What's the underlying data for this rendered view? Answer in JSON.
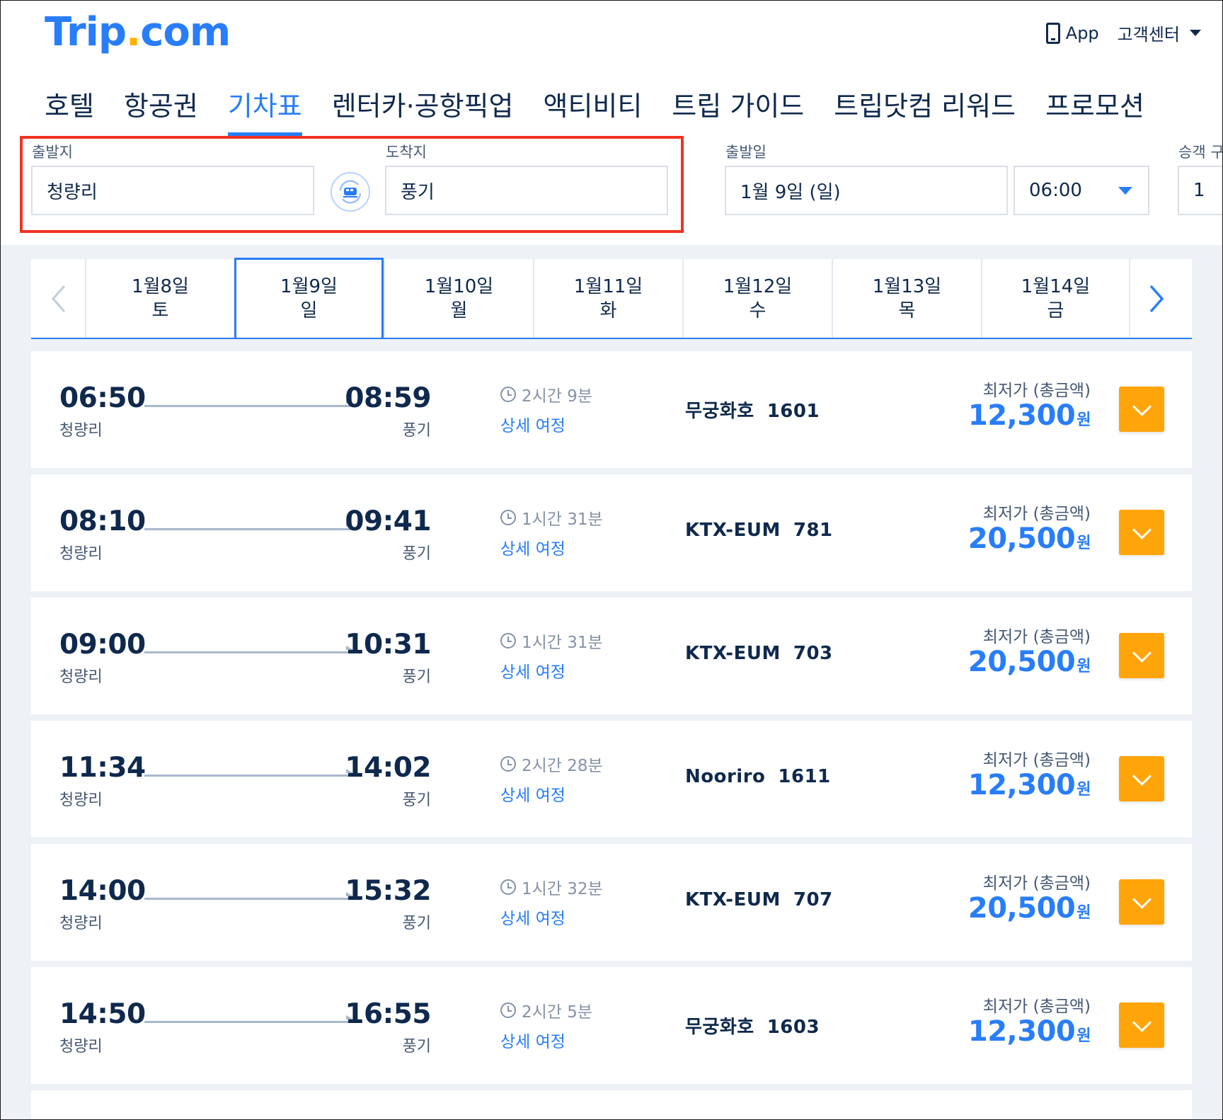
{
  "brand": {
    "name_part1": "Trip",
    "dot": ".",
    "name_part2": "com",
    "logo_color": "#287dfa",
    "dot_color": "#ffb000"
  },
  "header": {
    "app_label": "App",
    "support_label": "고객센터"
  },
  "tabs": [
    {
      "label": "호텔",
      "active": false
    },
    {
      "label": "항공권",
      "active": false
    },
    {
      "label": "기차표",
      "active": true
    },
    {
      "label": "렌터카·공항픽업",
      "active": false
    },
    {
      "label": "액티비티",
      "active": false
    },
    {
      "label": "트립 가이드",
      "active": false
    },
    {
      "label": "트립닷컴 리워드",
      "active": false
    },
    {
      "label": "프로모션",
      "active": false
    }
  ],
  "search": {
    "from_label": "출발지",
    "from_value": "청량리",
    "to_label": "도착지",
    "to_value": "풍기",
    "date_label": "출발일",
    "date_value": "1월 9일 (일)",
    "time_value": "06:00",
    "passenger_label": "승객 구",
    "passenger_value": "1"
  },
  "dates": [
    {
      "date": "1월8일",
      "day": "토"
    },
    {
      "date": "1월9일",
      "day": "일",
      "selected": true
    },
    {
      "date": "1월10일",
      "day": "월"
    },
    {
      "date": "1월11일",
      "day": "화"
    },
    {
      "date": "1월12일",
      "day": "수"
    },
    {
      "date": "1월13일",
      "day": "목"
    },
    {
      "date": "1월14일",
      "day": "금"
    }
  ],
  "results": [
    {
      "dep": "06:50",
      "dep_station": "청량리",
      "arr": "08:59",
      "arr_station": "풍기",
      "duration": "2시간 9분",
      "detail": "상세 여정",
      "train": "무궁화호",
      "number": "1601",
      "price_label": "최저가 (총금액)",
      "price": "12,300",
      "currency": "원"
    },
    {
      "dep": "08:10",
      "dep_station": "청량리",
      "arr": "09:41",
      "arr_station": "풍기",
      "duration": "1시간 31분",
      "detail": "상세 여정",
      "train": "KTX-EUM",
      "number": "781",
      "price_label": "최저가 (총금액)",
      "price": "20,500",
      "currency": "원"
    },
    {
      "dep": "09:00",
      "dep_station": "청량리",
      "arr": "10:31",
      "arr_station": "풍기",
      "duration": "1시간 31분",
      "detail": "상세 여정",
      "train": "KTX-EUM",
      "number": "703",
      "price_label": "최저가 (총금액)",
      "price": "20,500",
      "currency": "원"
    },
    {
      "dep": "11:34",
      "dep_station": "청량리",
      "arr": "14:02",
      "arr_station": "풍기",
      "duration": "2시간 28분",
      "detail": "상세 여정",
      "train": "Nooriro",
      "number": "1611",
      "price_label": "최저가 (총금액)",
      "price": "12,300",
      "currency": "원"
    },
    {
      "dep": "14:00",
      "dep_station": "청량리",
      "arr": "15:32",
      "arr_station": "풍기",
      "duration": "1시간 32분",
      "detail": "상세 여정",
      "train": "KTX-EUM",
      "number": "707",
      "price_label": "최저가 (총금액)",
      "price": "20,500",
      "currency": "원"
    },
    {
      "dep": "14:50",
      "dep_station": "청량리",
      "arr": "16:55",
      "arr_station": "풍기",
      "duration": "2시간 5분",
      "detail": "상세 여정",
      "train": "무궁화호",
      "number": "1603",
      "price_label": "최저가 (총금액)",
      "price": "12,300",
      "currency": "원"
    }
  ],
  "colors": {
    "accent": "#287dfa",
    "cta": "#ffa50a",
    "highlight_box": "#f03323"
  }
}
